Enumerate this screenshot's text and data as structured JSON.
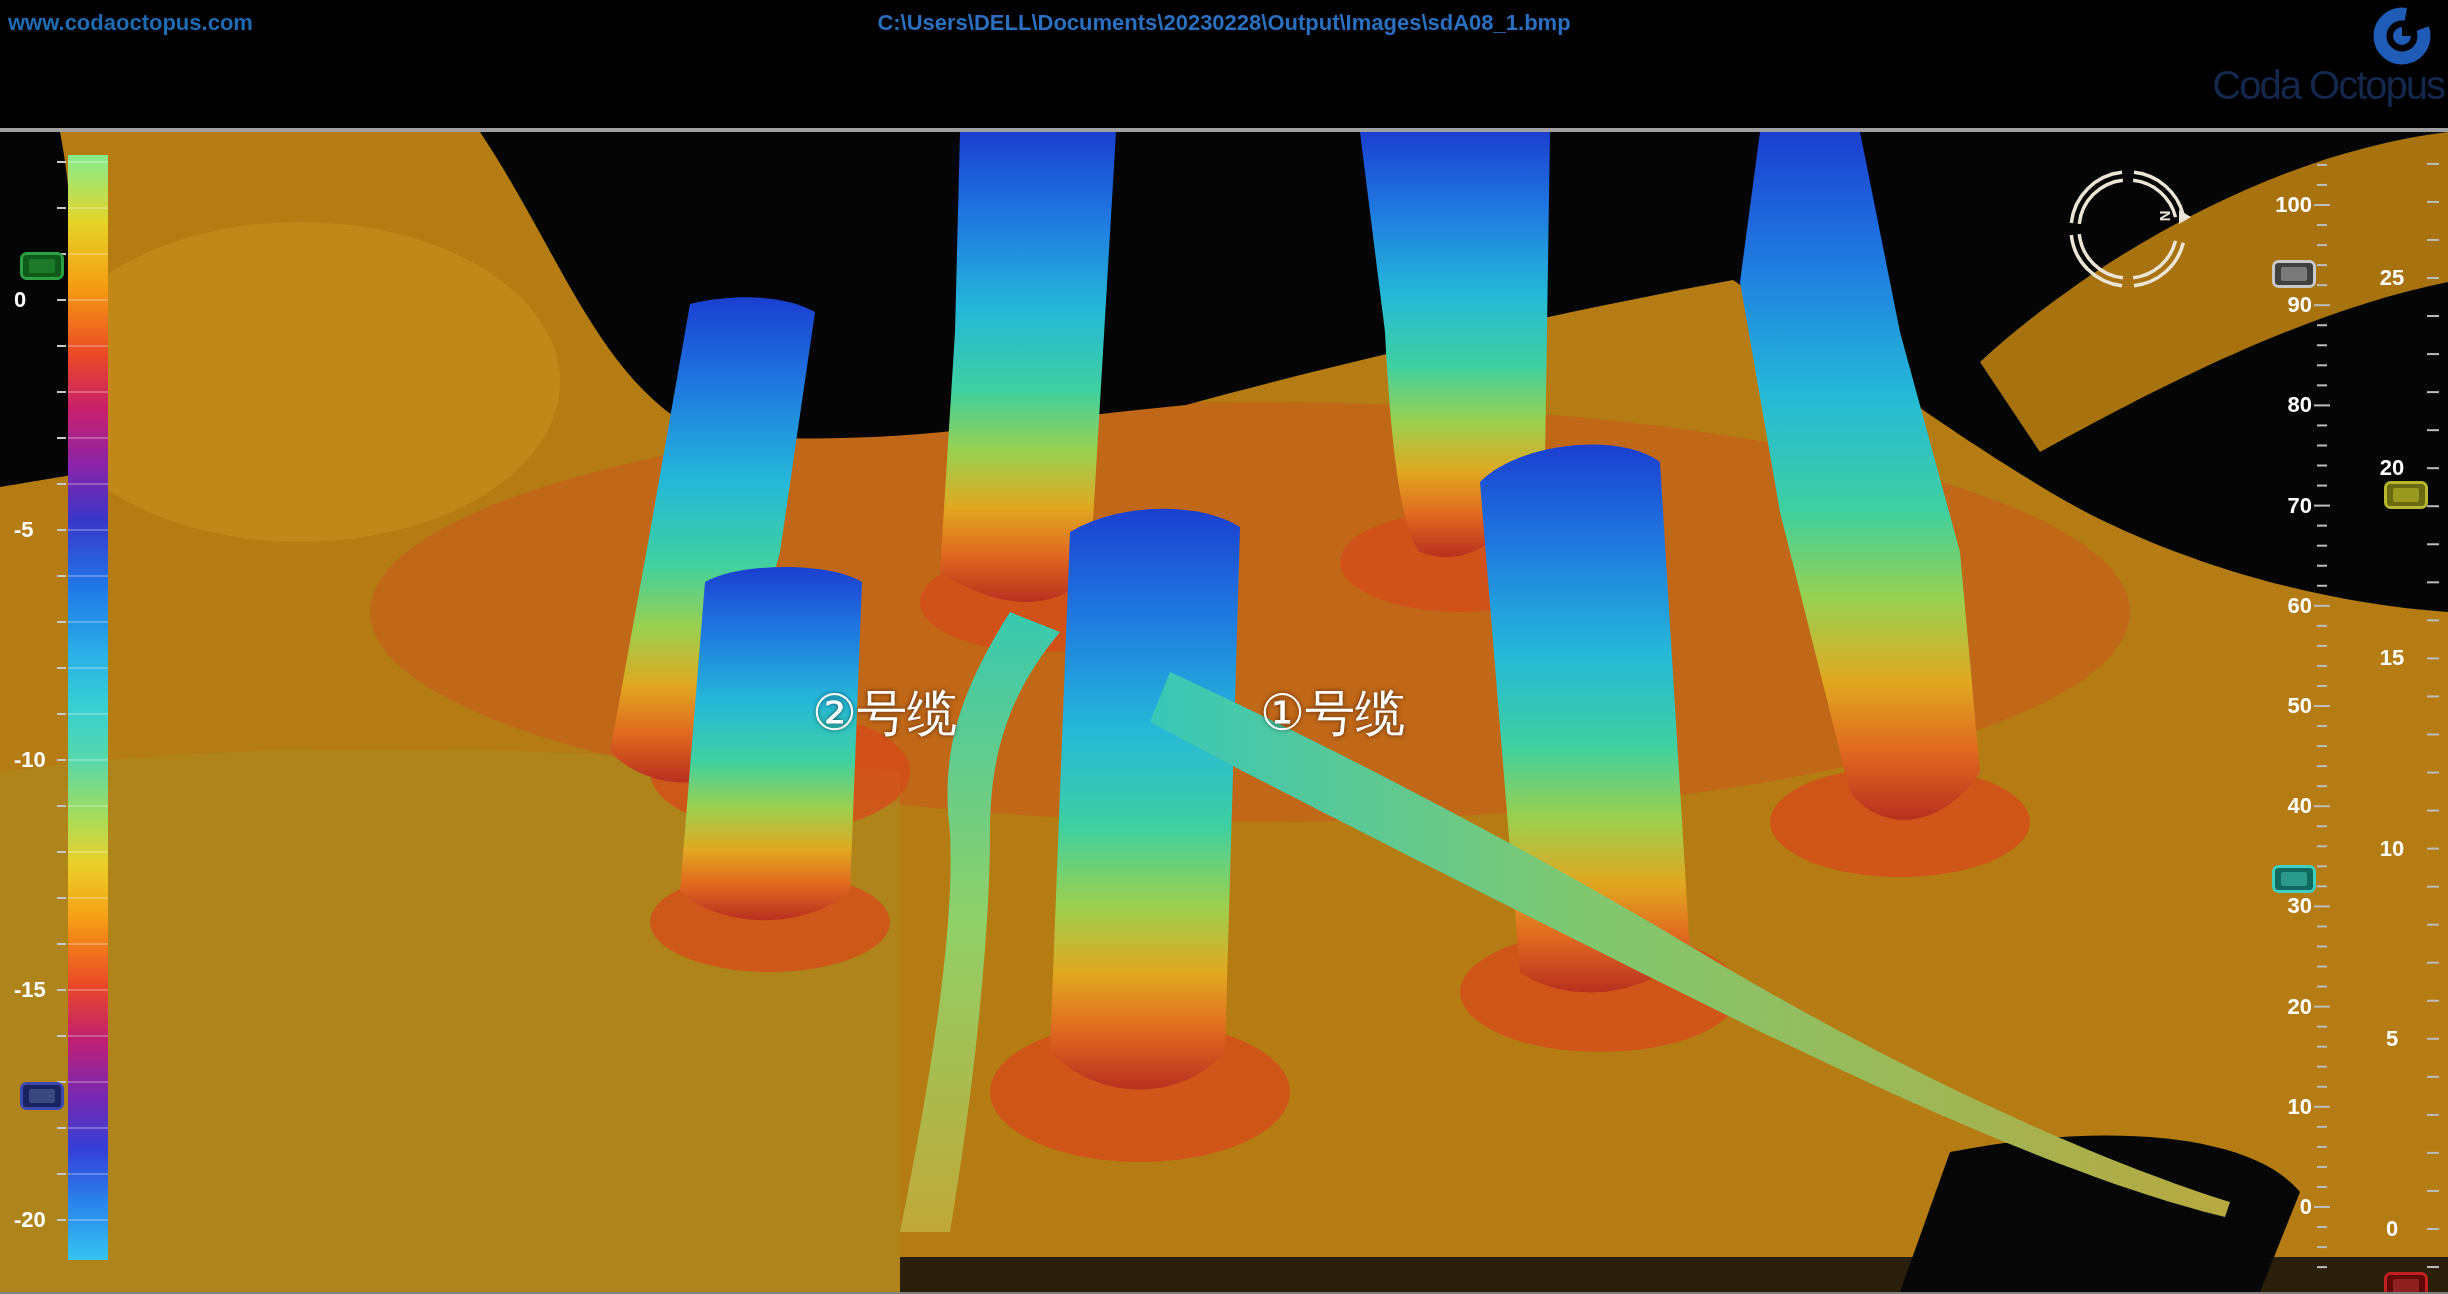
{
  "header": {
    "website": "www.codaoctopus.com",
    "file_path": "C:\\Users\\DELL\\Documents\\20230228\\Output\\Images\\sdA08_1.bmp",
    "logo_text": "Coda Octopus"
  },
  "depth_color_bar": {
    "labels": [
      "0",
      "-5",
      "-10",
      "-15",
      "-20"
    ]
  },
  "scale_inner": {
    "labels": [
      "100",
      "90",
      "80",
      "70",
      "60",
      "50",
      "40",
      "30",
      "20",
      "10",
      "0"
    ]
  },
  "scale_outer": {
    "labels": [
      "25",
      "20",
      "15",
      "10",
      "5",
      "0"
    ]
  },
  "compass": {
    "north_label": "N"
  },
  "annotations": [
    {
      "text": "②号缆"
    },
    {
      "text": "①号缆"
    }
  ]
}
